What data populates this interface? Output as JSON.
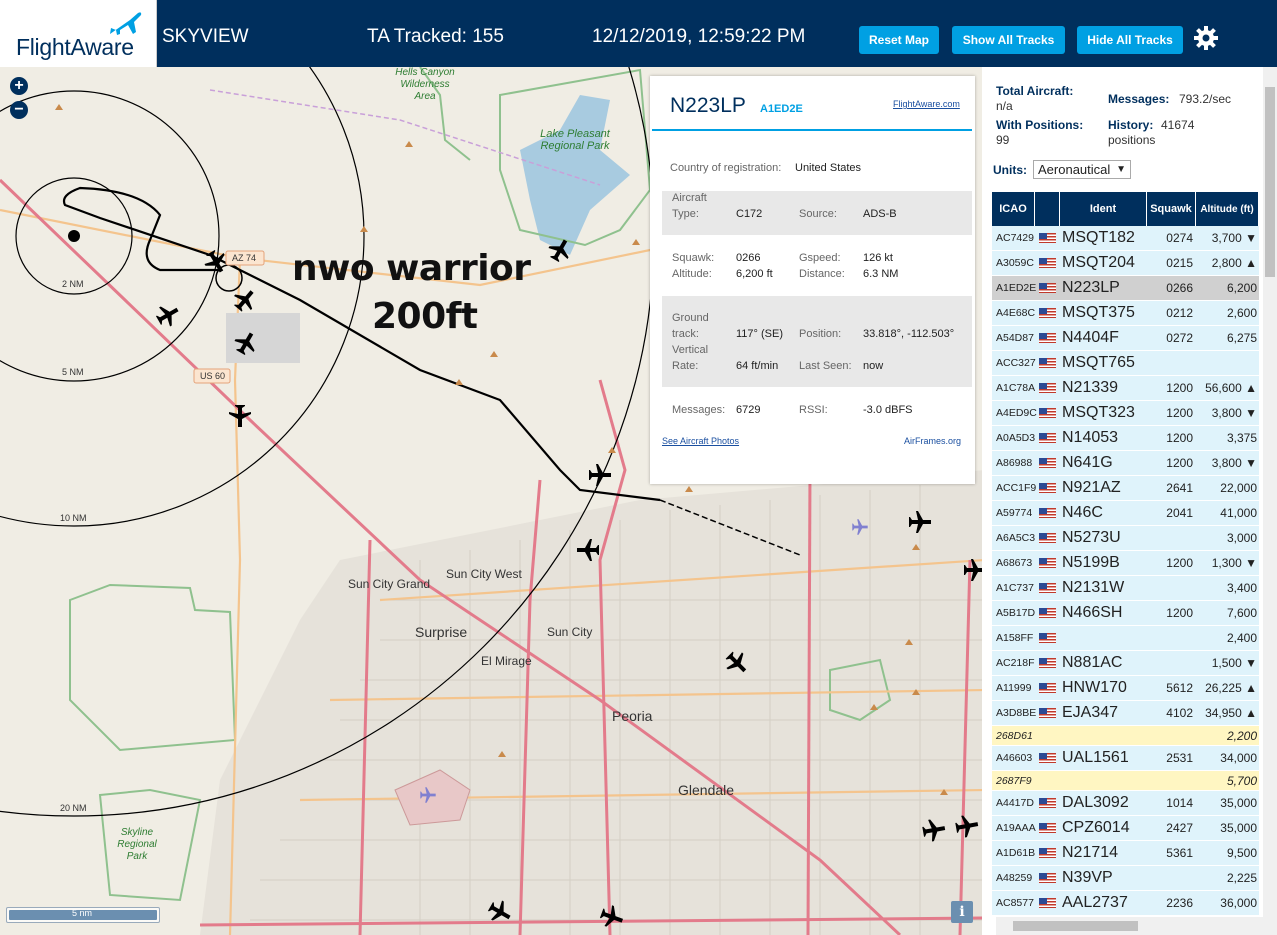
{
  "header": {
    "brand": "FlightAware",
    "title": "SKYVIEW",
    "tracked": "TA Tracked: 155",
    "datetime": "12/12/2019, 12:59:22 PM",
    "reset_label": "Reset Map",
    "show_label": "Show All Tracks",
    "hide_label": "Hide All Tracks"
  },
  "map": {
    "zoom_in": "+",
    "zoom_out": "−",
    "scale_label": "5 nm",
    "info_label": "i",
    "annotation_line1": "nwo warrior",
    "annotation_line2": "200ft",
    "range_rings": [
      "2 NM",
      "5 NM",
      "10 NM",
      "20 NM"
    ],
    "towns": [
      "Sun City Grand",
      "Sun City West",
      "Surprise",
      "Sun City",
      "El Mirage",
      "Peoria",
      "Glendale"
    ],
    "parks": [
      "Hells Canyon Wilderness Area",
      "Lake Pleasant Regional Park",
      "Skyline Regional Park"
    ],
    "route_shields": [
      "AZ 74",
      "US 60"
    ]
  },
  "popup": {
    "ident": "N223LP",
    "icao": "A1ED2E",
    "fa_link": "FlightAware.com",
    "country_label": "Country of registration:",
    "country_value": "United States",
    "type_label1": "Aircraft",
    "type_label2": "Type:",
    "type_value": "C172",
    "source_label": "Source:",
    "source_value": "ADS-B",
    "squawk_label": "Squawk:",
    "squawk_value": "0266",
    "gspeed_label": "Gspeed:",
    "gspeed_value": "126 kt",
    "altitude_label": "Altitude:",
    "altitude_value": "6,200 ft",
    "distance_label": "Distance:",
    "distance_value": "6.3 NM",
    "track_label1": "Ground",
    "track_label2": "track:",
    "track_value": "117° (SE)",
    "position_label": "Position:",
    "position_value": "33.818°, -112.503°",
    "vrate_label1": "Vertical",
    "vrate_label2": "Rate:",
    "vrate_value": "64 ft/min",
    "lastseen_label": "Last Seen:",
    "lastseen_value": "now",
    "messages_label": "Messages:",
    "messages_value": "6729",
    "rssi_label": "RSSI:",
    "rssi_value": "-3.0 dBFS",
    "photos_link": "See Aircraft Photos",
    "airframes_link": "AirFrames.org"
  },
  "sidebar": {
    "total_label": "Total Aircraft:",
    "total_value": "n/a",
    "positions_label": "With Positions:",
    "positions_value": "99",
    "messages_label": "Messages:",
    "messages_value": "793.2/sec",
    "history_label": "History:",
    "history_value": "41674",
    "history_unit": "positions",
    "units_label": "Units:",
    "units_value": "Aeronautical",
    "columns": [
      "ICAO",
      "",
      "Ident",
      "Squawk",
      "Altitude (ft)"
    ],
    "rows": [
      {
        "icao": "AC7429",
        "flag": true,
        "ident": "MSQT182",
        "squawk": "0274",
        "alt": "3,700 ▼"
      },
      {
        "icao": "A3059C",
        "flag": true,
        "ident": "MSQT204",
        "squawk": "0215",
        "alt": "2,800 ▲"
      },
      {
        "icao": "A1ED2E",
        "flag": true,
        "ident": "N223LP",
        "squawk": "0266",
        "alt": "6,200",
        "sel": true
      },
      {
        "icao": "A4E68C",
        "flag": true,
        "ident": "MSQT375",
        "squawk": "0212",
        "alt": "2,600"
      },
      {
        "icao": "A54D87",
        "flag": true,
        "ident": "N4404F",
        "squawk": "0272",
        "alt": "6,275"
      },
      {
        "icao": "ACC327",
        "flag": true,
        "ident": "MSQT765",
        "squawk": "",
        "alt": ""
      },
      {
        "icao": "A1C78A",
        "flag": true,
        "ident": "N21339",
        "squawk": "1200",
        "alt": "56,600 ▲"
      },
      {
        "icao": "A4ED9C",
        "flag": true,
        "ident": "MSQT323",
        "squawk": "1200",
        "alt": "3,800 ▼"
      },
      {
        "icao": "A0A5D3",
        "flag": true,
        "ident": "N14053",
        "squawk": "1200",
        "alt": "3,375"
      },
      {
        "icao": "A86988",
        "flag": true,
        "ident": "N641G",
        "squawk": "1200",
        "alt": "3,800 ▼"
      },
      {
        "icao": "ACC1F9",
        "flag": true,
        "ident": "N921AZ",
        "squawk": "2641",
        "alt": "22,000"
      },
      {
        "icao": "A59774",
        "flag": true,
        "ident": "N46C",
        "squawk": "2041",
        "alt": "41,000"
      },
      {
        "icao": "A6A5C3",
        "flag": true,
        "ident": "N5273U",
        "squawk": "",
        "alt": "3,000"
      },
      {
        "icao": "A68673",
        "flag": true,
        "ident": "N5199B",
        "squawk": "1200",
        "alt": "1,300 ▼"
      },
      {
        "icao": "A1C737",
        "flag": true,
        "ident": "N2131W",
        "squawk": "",
        "alt": "3,400"
      },
      {
        "icao": "A5B17D",
        "flag": true,
        "ident": "N466SH",
        "squawk": "1200",
        "alt": "7,600"
      },
      {
        "icao": "A158FF",
        "flag": true,
        "ident": "",
        "squawk": "",
        "alt": "2,400"
      },
      {
        "icao": "AC218F",
        "flag": true,
        "ident": "N881AC",
        "squawk": "",
        "alt": "1,500 ▼"
      },
      {
        "icao": "A11999",
        "flag": true,
        "ident": "HNW170",
        "squawk": "5612",
        "alt": "26,225 ▲"
      },
      {
        "icao": "A3D8BE",
        "flag": true,
        "ident": "EJA347",
        "squawk": "4102",
        "alt": "34,950 ▲"
      },
      {
        "icao": "268D61",
        "flag": false,
        "ident": "",
        "squawk": "",
        "alt": "2,200",
        "yel": true
      },
      {
        "icao": "A46603",
        "flag": true,
        "ident": "UAL1561",
        "squawk": "2531",
        "alt": "34,000"
      },
      {
        "icao": "2687F9",
        "flag": false,
        "ident": "",
        "squawk": "",
        "alt": "5,700",
        "yel": true
      },
      {
        "icao": "A4417D",
        "flag": true,
        "ident": "DAL3092",
        "squawk": "1014",
        "alt": "35,000"
      },
      {
        "icao": "A19AAA",
        "flag": true,
        "ident": "CPZ6014",
        "squawk": "2427",
        "alt": "35,000"
      },
      {
        "icao": "A1D61B",
        "flag": true,
        "ident": "N21714",
        "squawk": "5361",
        "alt": "9,500"
      },
      {
        "icao": "A48259",
        "flag": true,
        "ident": "N39VP",
        "squawk": "",
        "alt": "2,225"
      },
      {
        "icao": "AC8577",
        "flag": true,
        "ident": "AAL2737",
        "squawk": "2236",
        "alt": "36,000"
      }
    ]
  },
  "colors": {
    "header": "#002f5d",
    "accent": "#00a0e3",
    "row": "#dff3fb",
    "row_no_pos": "#fff6c2"
  }
}
